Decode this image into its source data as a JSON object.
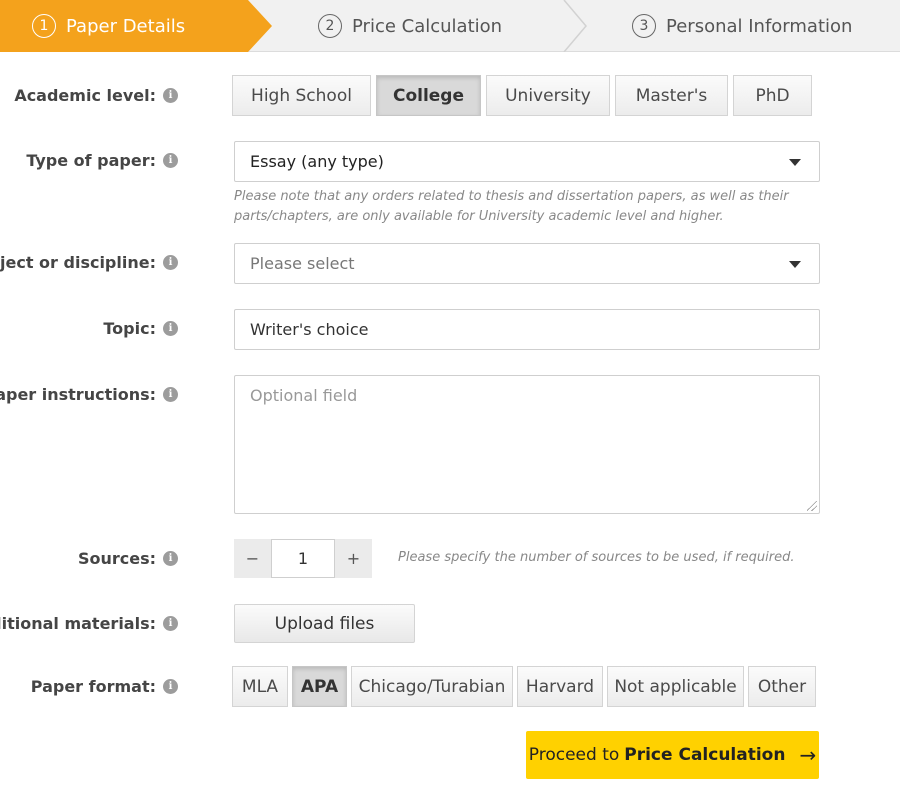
{
  "steps": [
    {
      "num": "1",
      "label": "Paper Details"
    },
    {
      "num": "2",
      "label": "Price Calculation"
    },
    {
      "num": "3",
      "label": "Personal Information"
    }
  ],
  "academic_level": {
    "label": "Academic level:",
    "options": [
      "High School",
      "College",
      "University",
      "Master's",
      "PhD"
    ],
    "selected": "College"
  },
  "type_of_paper": {
    "label": "Type of paper:",
    "value": "Essay (any type)",
    "note": "Please note that any orders related to thesis and dissertation papers, as well as their parts/chapters, are only available for University academic level and higher."
  },
  "subject": {
    "label": "Subject or discipline:",
    "placeholder": "Please select"
  },
  "topic": {
    "label": "Topic:",
    "value": "Writer's choice"
  },
  "instructions": {
    "label": "Paper instructions:",
    "placeholder": "Optional field"
  },
  "sources": {
    "label": "Sources:",
    "minus": "−",
    "value": "1",
    "plus": "+",
    "hint": "Please specify the number of sources to be used, if required."
  },
  "materials": {
    "label": "Additional materials:",
    "button": "Upload files"
  },
  "paper_format": {
    "label": "Paper format:",
    "options": [
      "MLA",
      "APA",
      "Chicago/Turabian",
      "Harvard",
      "Not applicable",
      "Other"
    ],
    "selected": "APA"
  },
  "proceed": {
    "prefix": "Proceed to",
    "target": "Price Calculation",
    "arrow": "→"
  },
  "colors": {
    "active_step": "#f4a21c",
    "proceed_button": "#ffd100"
  }
}
